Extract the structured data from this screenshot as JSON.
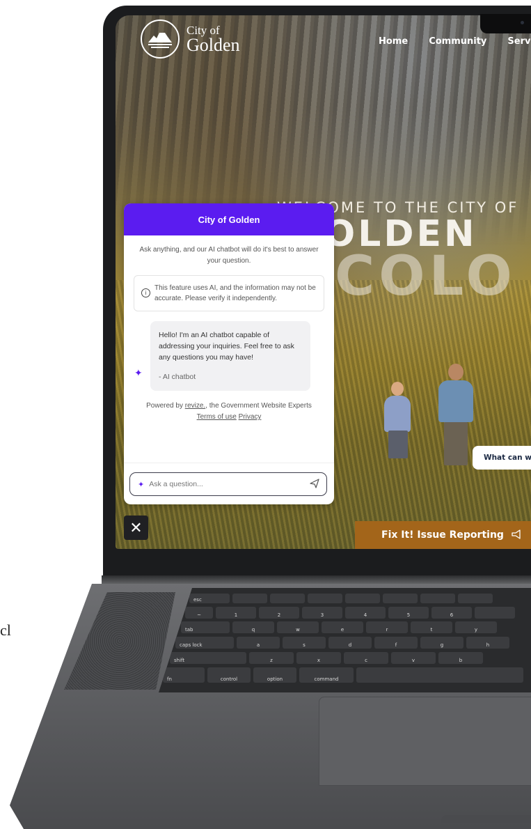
{
  "stray_text": "cl",
  "site": {
    "logo_top": "City of",
    "logo_bottom": "Golden",
    "nav": [
      "Home",
      "Community",
      "Servi"
    ],
    "hero_small": "WELCOME TO THE CITY OF",
    "hero_big": "OLDEN",
    "hero_ghost": "COLO",
    "what_can": "What can w",
    "fixit_label": "Fix It! Issue Reporting"
  },
  "chat": {
    "title": "City of Golden",
    "intro": "Ask anything, and our AI chatbot will do it's best to answer your question.",
    "notice": "This feature uses AI, and the information may not be accurate. Please verify it independently.",
    "message": "Hello! I'm an AI chatbot capable of addressing your inquiries. Feel free to ask any questions you may have!",
    "signature": "- AI chatbot",
    "powered_prefix": "Powered by ",
    "powered_brand": "revize.",
    "powered_mid": ", the Government Website Experts ",
    "terms": "Terms of use",
    "privacy": "Privacy",
    "input_placeholder": "Ask a question...",
    "close_glyph": "✕"
  },
  "colors": {
    "chat_header": "#5b1cf0",
    "fixit": "#a3651a",
    "laptop": "#1b1c1e"
  },
  "keyboard": {
    "rows": [
      [
        "esc",
        "",
        "",
        "",
        "",
        "",
        "",
        ""
      ],
      [
        "~",
        "1",
        "2",
        "3",
        "4",
        "5",
        "6",
        ""
      ],
      [
        "tab",
        "q",
        "w",
        "e",
        "r",
        "t",
        "y"
      ],
      [
        "caps lock",
        "a",
        "s",
        "d",
        "f",
        "g",
        "h"
      ],
      [
        "shift",
        "z",
        "x",
        "c",
        "v",
        "b"
      ],
      [
        "fn",
        "control",
        "option",
        "command",
        ""
      ]
    ]
  }
}
